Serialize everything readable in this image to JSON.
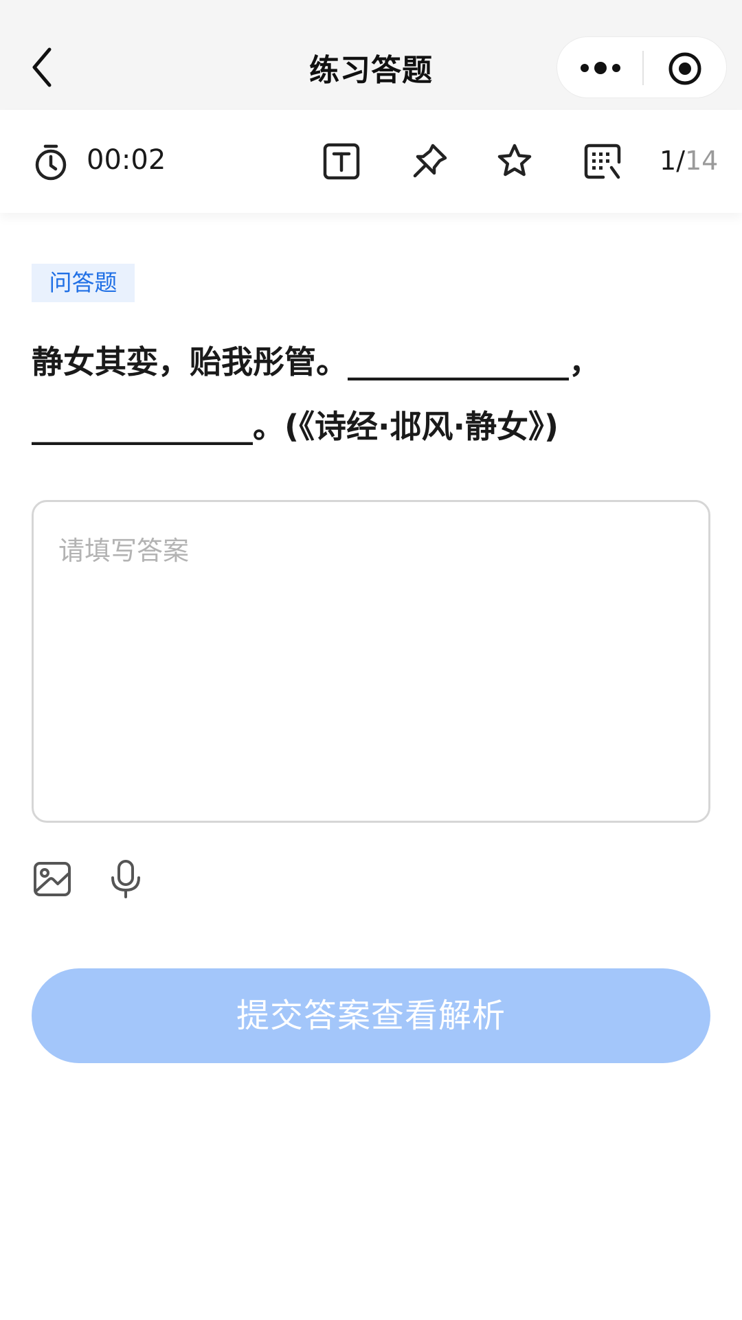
{
  "navbar": {
    "title": "练习答题",
    "back_icon": "chevron-left-icon",
    "more_icon": "more-dots-icon",
    "close_icon": "target-close-icon"
  },
  "toolbar": {
    "timer_icon": "stopwatch-icon",
    "timer": "00:02",
    "icons": [
      "text-size-icon",
      "pin-icon",
      "star-icon",
      "answer-card-icon"
    ],
    "progress": {
      "current": "1",
      "separator": "/",
      "total": "14"
    }
  },
  "question": {
    "type_tag": "问答题",
    "line1": "静女其娈，贻我彤管。______________，",
    "line2": "______________。(《诗经·邶风·静女》)"
  },
  "answer": {
    "placeholder": "请填写答案",
    "value": "",
    "attach_icons": [
      "image-icon",
      "microphone-icon"
    ]
  },
  "submit": {
    "label": "提交答案查看解析"
  },
  "colors": {
    "accent": "#1f6fe5",
    "tag_bg": "#e9f1fd",
    "submit_disabled": "#a3c6fa",
    "navbar_bg": "#f5f5f5",
    "placeholder": "#b3b3b3"
  }
}
